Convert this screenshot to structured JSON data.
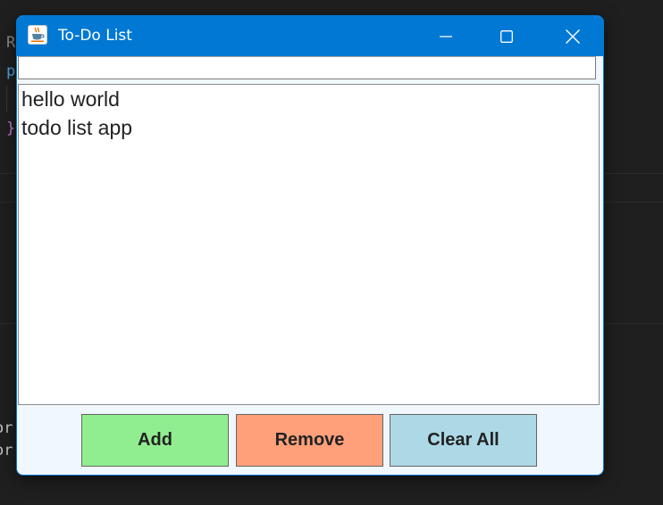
{
  "window": {
    "title": "To-Do List",
    "app_icon": "java-coffee-cup-icon",
    "controls": {
      "minimize_icon": "minimize-icon",
      "maximize_icon": "maximize-icon",
      "close_icon": "close-icon"
    },
    "accent_color": "#0078d4"
  },
  "input": {
    "value": ""
  },
  "todo_list": {
    "items": [
      "hello world",
      "todo list app"
    ]
  },
  "buttons": {
    "add_label": "Add",
    "remove_label": "Remove",
    "clear_all_label": "Clear All",
    "add_color": "#90ee90",
    "remove_color": "#ffa07a",
    "clear_all_color": "#add8e6"
  },
  "background_editor": {
    "fragment_1": "R",
    "fragment_2": "p",
    "fragment_3": "}",
    "fragment_4": "or",
    "fragment_5": "or"
  }
}
